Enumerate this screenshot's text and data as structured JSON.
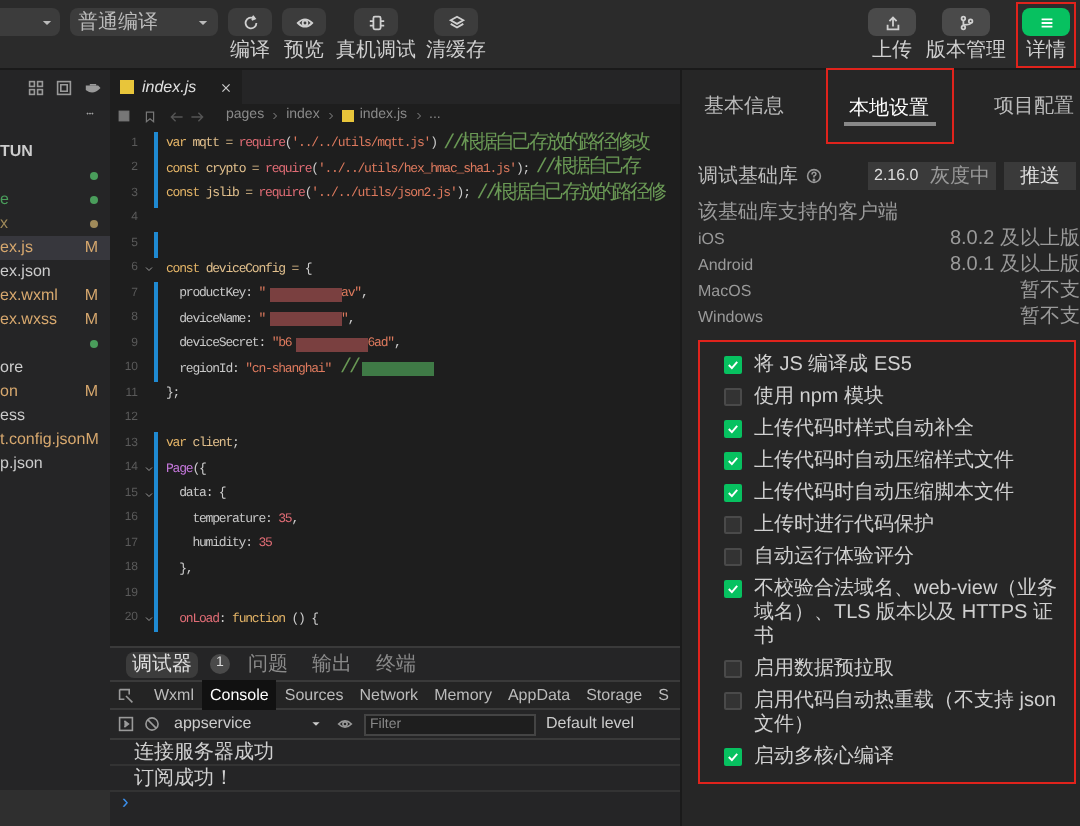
{
  "toolbar": {
    "mode_select": {
      "value": "普通编译"
    },
    "tools": [
      {
        "label": "编译"
      },
      {
        "label": "预览"
      },
      {
        "label": "真机调试"
      },
      {
        "label": "清缓存"
      }
    ],
    "right_tools": [
      {
        "label": "上传",
        "selected": false
      },
      {
        "label": "版本管理",
        "selected": false
      },
      {
        "label": "详情",
        "selected": true
      }
    ]
  },
  "explorer": {
    "header": "TUN",
    "items": [
      {
        "color": "#4a9d5b",
        "selected": false
      },
      {
        "name": "e",
        "color": "#4a9d5b",
        "selected": false
      },
      {
        "name": "x",
        "color": "#a08a5a",
        "selected": false
      },
      {
        "name": "ex.js",
        "badge": "M",
        "selected": true
      },
      {
        "name": "ex.json",
        "selected": false
      },
      {
        "name": "ex.wxml",
        "badge": "M",
        "selected": false
      },
      {
        "name": "ex.wxss",
        "badge": "M",
        "selected": false
      },
      {
        "color": "#4a9d5b",
        "selected": false
      },
      {
        "name": "ore",
        "selected": false
      },
      {
        "name": "on",
        "badge": "M",
        "selected": false
      },
      {
        "name": "ess",
        "selected": false
      },
      {
        "name": "t.config.json",
        "badge": "M",
        "selected": false
      },
      {
        "name": "p.json",
        "selected": false
      }
    ]
  },
  "editor": {
    "tab": {
      "label": "index.js"
    },
    "breadcrumb": [
      "pages",
      "index",
      "index.js",
      "..."
    ],
    "lines": [
      {
        "n": "1",
        "modified": true,
        "fold": false,
        "tokens": [
          {
            "kind": "kw",
            "t": "var"
          },
          {
            "kind": "plain",
            "t": " mqtt = "
          },
          {
            "kind": "call",
            "t": "require"
          },
          {
            "kind": "punc",
            "t": "("
          },
          {
            "kind": "str",
            "t": "'../../utils/mqtt.js'"
          },
          {
            "kind": "punc",
            "t": ") "
          },
          {
            "kind": "com",
            "t": "//根据自己存放的路径修改"
          }
        ]
      },
      {
        "n": "2",
        "modified": true,
        "fold": false,
        "tokens": [
          {
            "kind": "kw",
            "t": "const"
          },
          {
            "kind": "plain",
            "t": " crypto = "
          },
          {
            "kind": "call",
            "t": "require"
          },
          {
            "kind": "punc",
            "t": "("
          },
          {
            "kind": "str",
            "t": "'../../utils/hex_hmac_sha1.js'"
          },
          {
            "kind": "punc",
            "t": "); "
          },
          {
            "kind": "com",
            "t": "//根据自己存"
          }
        ]
      },
      {
        "n": "3",
        "modified": true,
        "fold": false,
        "tokens": [
          {
            "kind": "kw",
            "t": "const"
          },
          {
            "kind": "plain",
            "t": " jslib = "
          },
          {
            "kind": "call",
            "t": "require"
          },
          {
            "kind": "punc",
            "t": "("
          },
          {
            "kind": "str",
            "t": "'../../utils/json2.js'"
          },
          {
            "kind": "punc",
            "t": "); "
          },
          {
            "kind": "com",
            "t": "//根据自己存放的路径修"
          }
        ]
      },
      {
        "n": "4",
        "modified": false,
        "fold": false
      },
      {
        "n": "5",
        "modified": true,
        "fold": false
      },
      {
        "n": "6",
        "modified": false,
        "fold": true,
        "tokens": [
          {
            "kind": "kw",
            "t": "const"
          },
          {
            "kind": "plain",
            "t": " deviceConfig = "
          },
          {
            "kind": "punc",
            "t": "{"
          }
        ]
      },
      {
        "n": "7",
        "modified": true,
        "fold": false,
        "tokens": [
          {
            "kind": "prop",
            "t": "  productKey"
          },
          {
            "kind": "punc",
            "t": ": "
          },
          {
            "kind": "str",
            "t": "\""
          },
          {
            "kind": "redacted_str"
          },
          {
            "kind": "str",
            "t": "av\""
          },
          {
            "kind": "punc",
            "t": ","
          }
        ]
      },
      {
        "n": "8",
        "modified": true,
        "fold": false,
        "tokens": [
          {
            "kind": "prop",
            "t": "  deviceName"
          },
          {
            "kind": "punc",
            "t": ": "
          },
          {
            "kind": "str",
            "t": "\""
          },
          {
            "kind": "redacted_str"
          },
          {
            "kind": "str",
            "t": "\""
          },
          {
            "kind": "punc",
            "t": ","
          }
        ]
      },
      {
        "n": "9",
        "modified": true,
        "fold": false,
        "tokens": [
          {
            "kind": "prop",
            "t": "  deviceSecret"
          },
          {
            "kind": "punc",
            "t": ": "
          },
          {
            "kind": "str",
            "t": "\"b6"
          },
          {
            "kind": "redacted_str"
          },
          {
            "kind": "str",
            "t": "6ad\""
          },
          {
            "kind": "punc",
            "t": ","
          }
        ]
      },
      {
        "n": "10",
        "modified": true,
        "fold": false,
        "tokens": [
          {
            "kind": "prop",
            "t": "  regionId"
          },
          {
            "kind": "punc",
            "t": ": "
          },
          {
            "kind": "str",
            "t": "\"cn-shanghai\""
          },
          {
            "kind": "com",
            "t": " //"
          },
          {
            "kind": "redacted_com"
          }
        ]
      },
      {
        "n": "11",
        "modified": false,
        "fold": false,
        "tokens": [
          {
            "kind": "punc",
            "t": "};"
          }
        ]
      },
      {
        "n": "12",
        "modified": false,
        "fold": false
      },
      {
        "n": "13",
        "modified": true,
        "fold": false,
        "tokens": [
          {
            "kind": "kw",
            "t": "var"
          },
          {
            "kind": "plain",
            "t": " client"
          },
          {
            "kind": "punc",
            "t": ";"
          }
        ]
      },
      {
        "n": "14",
        "modified": true,
        "fold": true,
        "tokens": [
          {
            "kind": "type",
            "t": "Page"
          },
          {
            "kind": "punc",
            "t": "({"
          }
        ]
      },
      {
        "n": "15",
        "modified": true,
        "fold": true,
        "tokens": [
          {
            "kind": "prop",
            "t": "  data"
          },
          {
            "kind": "punc",
            "t": ": {"
          }
        ]
      },
      {
        "n": "16",
        "modified": true,
        "fold": false,
        "tokens": [
          {
            "kind": "prop",
            "t": "    temperature"
          },
          {
            "kind": "punc",
            "t": ": "
          },
          {
            "kind": "num",
            "t": "35"
          },
          {
            "kind": "punc",
            "t": ","
          }
        ]
      },
      {
        "n": "17",
        "modified": true,
        "fold": false,
        "tokens": [
          {
            "kind": "prop",
            "t": "    humidity"
          },
          {
            "kind": "punc",
            "t": ": "
          },
          {
            "kind": "num",
            "t": "35"
          }
        ]
      },
      {
        "n": "18",
        "modified": true,
        "fold": false,
        "tokens": [
          {
            "kind": "punc",
            "t": "  },"
          }
        ]
      },
      {
        "n": "19",
        "modified": true,
        "fold": false
      },
      {
        "n": "20",
        "modified": true,
        "fold": true,
        "tokens": [
          {
            "kind": "call",
            "t": "  onLoad"
          },
          {
            "kind": "punc",
            "t": ": "
          },
          {
            "kind": "kw",
            "t": "function"
          },
          {
            "kind": "punc",
            "t": " () {"
          }
        ]
      }
    ]
  },
  "debugger": {
    "tabs": [
      {
        "label": "调试器",
        "badge": "1",
        "selected": true
      },
      {
        "label": "问题",
        "selected": false
      },
      {
        "label": "输出",
        "selected": false
      },
      {
        "label": "终端",
        "selected": false
      }
    ],
    "devtools_tabs": [
      {
        "label": "Wxml",
        "selected": false
      },
      {
        "label": "Console",
        "selected": true
      },
      {
        "label": "Sources",
        "selected": false
      },
      {
        "label": "Network",
        "selected": false
      },
      {
        "label": "Memory",
        "selected": false
      },
      {
        "label": "AppData",
        "selected": false
      },
      {
        "label": "Storage",
        "selected": false
      },
      {
        "label": "S",
        "selected": false
      }
    ],
    "context_select": {
      "value": "appservice"
    },
    "filter": {
      "placeholder": "Filter"
    },
    "level_select": {
      "value": "Default level"
    },
    "console_lines": [
      "连接服务器成功",
      "订阅成功！"
    ],
    "prompt": "›"
  },
  "details_panel": {
    "tabs": [
      {
        "label": "基本信息",
        "selected": false
      },
      {
        "label": "本地设置",
        "selected": true
      },
      {
        "label": "项目配置",
        "selected": false
      }
    ],
    "library": {
      "label": "调试基础库",
      "version": "2.16.0",
      "status": "灰度中",
      "button": "推送"
    },
    "support_title": "该基础库支持的客户端",
    "support": [
      {
        "platform": "iOS",
        "value": "8.0.2 及以上版"
      },
      {
        "platform": "Android",
        "value": "8.0.1 及以上版"
      },
      {
        "platform": "MacOS",
        "value": "暂不支"
      },
      {
        "platform": "Windows",
        "value": "暂不支"
      }
    ],
    "options": [
      {
        "label": "将 JS 编译成 ES5",
        "checked": true
      },
      {
        "label": "使用 npm 模块",
        "checked": false
      },
      {
        "label": "上传代码时样式自动补全",
        "checked": true
      },
      {
        "label": "上传代码时自动压缩样式文件",
        "checked": true
      },
      {
        "label": "上传代码时自动压缩脚本文件",
        "checked": true
      },
      {
        "label": "上传时进行代码保护",
        "checked": false
      },
      {
        "label": "自动运行体验评分",
        "checked": false
      },
      {
        "label": "不校验合法域名、web-view（业务域名）、TLS 版本以及 HTTPS 证书",
        "checked": true
      },
      {
        "label": "启用数据预拉取",
        "checked": false
      },
      {
        "label": "启用代码自动热重载（不支持 json 文件）",
        "checked": false
      },
      {
        "label": "启动多核心编译",
        "checked": true
      }
    ]
  }
}
